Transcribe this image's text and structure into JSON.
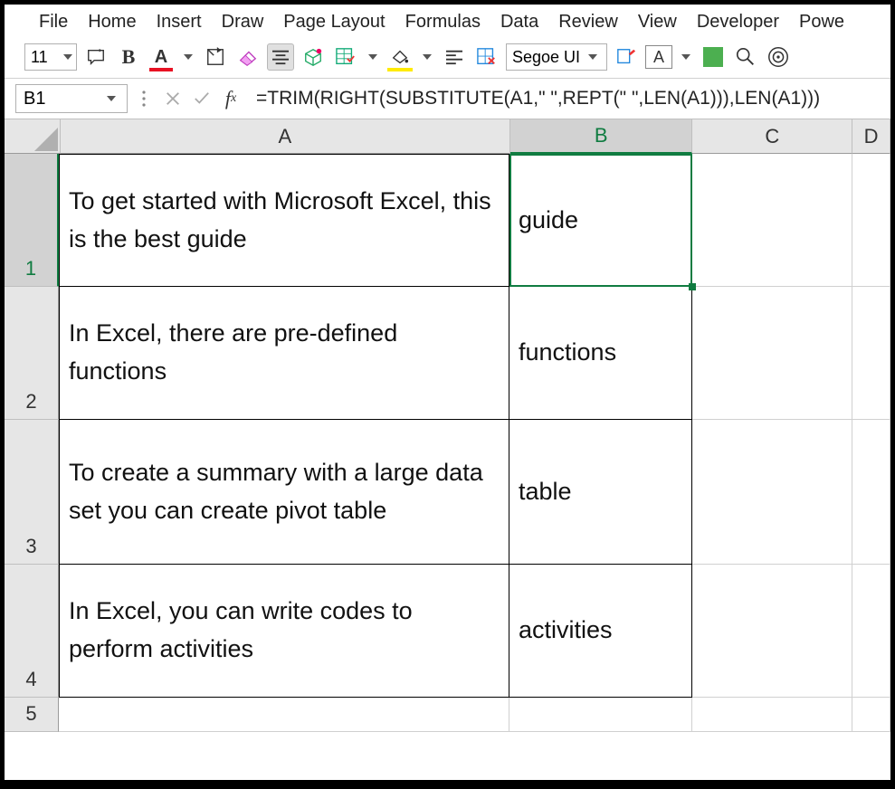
{
  "menus": {
    "file": "File",
    "home": "Home",
    "insert": "Insert",
    "draw": "Draw",
    "pagelayout": "Page Layout",
    "formulas": "Formulas",
    "data": "Data",
    "review": "Review",
    "view": "View",
    "developer": "Developer",
    "powe": "Powe"
  },
  "toolbar": {
    "fontsize": "11",
    "fontname": "Segoe UI",
    "boxlabel": "A"
  },
  "formula": {
    "namebox": "B1",
    "text": "=TRIM(RIGHT(SUBSTITUTE(A1,\" \",REPT(\" \",LEN(A1))),LEN(A1)))"
  },
  "columns": {
    "A": "A",
    "B": "B",
    "C": "C",
    "D": "D"
  },
  "rowlabels": {
    "r1": "1",
    "r2": "2",
    "r3": "3",
    "r4": "4",
    "r5": "5"
  },
  "cells": {
    "A1": "To get started with Microsoft Excel, this is the best guide",
    "B1": "guide",
    "A2": "In Excel, there are pre-defined functions",
    "B2": "functions",
    "A3": "To create a summary with a large data set you can create pivot table",
    "B3": "table",
    "A4": "In Excel, you can write codes to perform activities",
    "B4": "activities"
  }
}
